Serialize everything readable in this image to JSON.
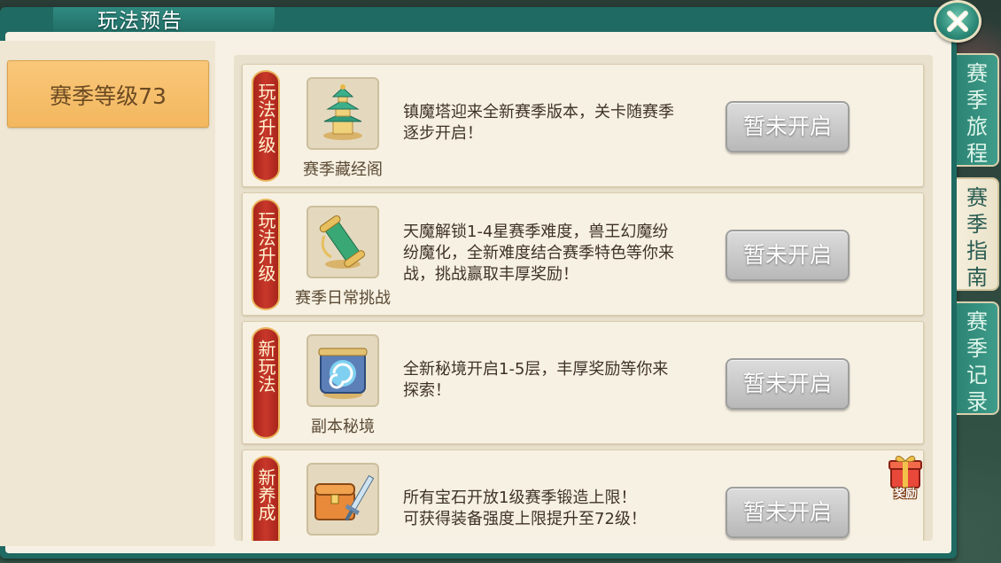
{
  "window": {
    "title": "玩法预告"
  },
  "categories": [
    {
      "label": "赛季等级73"
    }
  ],
  "cards": [
    {
      "tag": [
        "玩",
        "法",
        "升",
        "级"
      ],
      "icon": "pagoda-icon",
      "caption": "赛季藏经阁",
      "description": [
        "镇魔塔迎来全新赛季版本，关卡随赛季",
        "逐步开启！"
      ],
      "button": "暂未开启"
    },
    {
      "tag": [
        "玩",
        "法",
        "升",
        "级"
      ],
      "icon": "scroll-icon",
      "caption": "赛季日常挑战",
      "description": [
        "天魔解锁1-4星赛季难度，兽王幻魔纷",
        "纷魔化，全新难度结合赛季特色等你来",
        "战，挑战赢取丰厚奖励！"
      ],
      "button": "暂未开启"
    },
    {
      "tag": [
        "新",
        "玩",
        "法"
      ],
      "icon": "portal-icon",
      "caption": "副本秘境",
      "description": [
        "全新秘境开启1-5层，丰厚奖励等你来",
        "探索！"
      ],
      "button": "暂未开启"
    },
    {
      "tag": [
        "新",
        "养",
        "成"
      ],
      "icon": "chest-sword-icon",
      "caption": "",
      "description": [
        "所有宝石开放1级赛季锻造上限！",
        "可获得装备强度上限提升至72级！"
      ],
      "button": "暂未开启",
      "badge": "奖励"
    }
  ],
  "side_tabs": [
    {
      "label": [
        "赛",
        "季",
        "旅",
        "程"
      ],
      "active": false
    },
    {
      "label": [
        "赛",
        "季",
        "指",
        "南"
      ],
      "active": true
    },
    {
      "label": [
        "赛",
        "季",
        "记",
        "录"
      ],
      "active": false
    }
  ],
  "colors": {
    "frame": "#1f6a62",
    "category_active": "#f3b75e",
    "ribbon": "#c8382a",
    "disabled_button": "#c4c4c4"
  }
}
